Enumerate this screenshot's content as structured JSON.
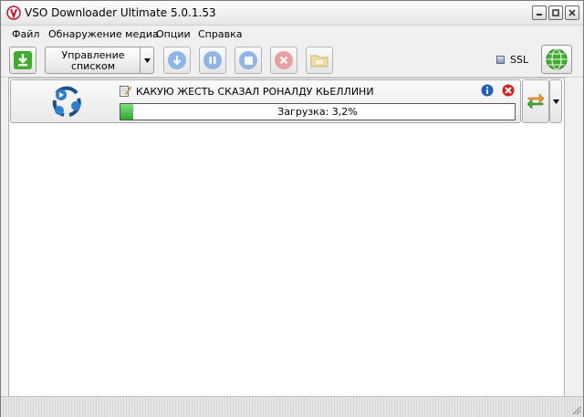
{
  "window": {
    "title": "VSO Downloader Ultimate 5.0.1.53"
  },
  "menu": {
    "items": [
      "Файл",
      "Обнаружение медиа",
      "Опции",
      "Справка"
    ]
  },
  "toolbar": {
    "list_button_line1": "Управление",
    "list_button_line2": "списком",
    "ssl_label": "SSL"
  },
  "download": {
    "title": "КАКУЮ ЖЕСТЬ СКАЗАЛ РОНАЛДУ КЬЕЛЛИНИ",
    "progress_label": "Загрузка: 3,2%",
    "progress_fraction": 0.032
  },
  "colors": {
    "accent_green": "#2ea82e",
    "disabled_blue": "#8fb5e6",
    "disabled_red": "#e8a0a0"
  }
}
